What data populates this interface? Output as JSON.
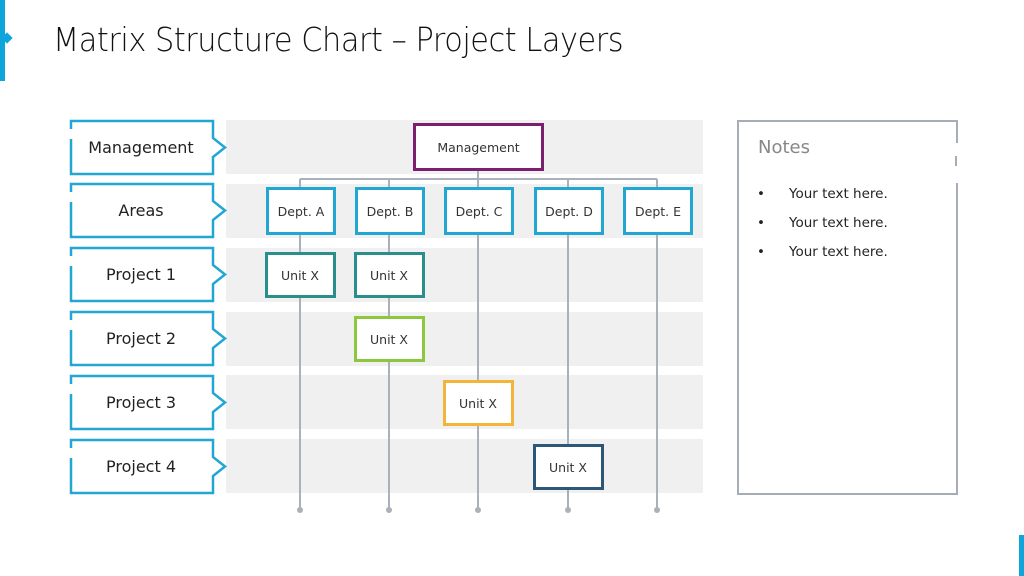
{
  "slide": {
    "title": "Matrix Structure Chart – Project Layers",
    "accent_color": "#0ea5dc"
  },
  "rows": [
    {
      "label": "Management"
    },
    {
      "label": "Areas"
    },
    {
      "label": "Project 1"
    },
    {
      "label": "Project 2"
    },
    {
      "label": "Project 3"
    },
    {
      "label": "Project 4"
    }
  ],
  "management_node": {
    "label": "Management",
    "color": "#7b1f6f"
  },
  "departments": [
    {
      "label": "Dept. A",
      "color": "#22a7d3"
    },
    {
      "label": "Dept. B",
      "color": "#22a7d3"
    },
    {
      "label": "Dept. C",
      "color": "#22a7d3"
    },
    {
      "label": "Dept. D",
      "color": "#22a7d3"
    },
    {
      "label": "Dept. E",
      "color": "#22a7d3"
    }
  ],
  "units": [
    {
      "label": "Unit X",
      "project": "Project 1",
      "department": "Dept. A",
      "color": "#2a8f8c"
    },
    {
      "label": "Unit X",
      "project": "Project 1",
      "department": "Dept. B",
      "color": "#2a8f8c"
    },
    {
      "label": "Unit X",
      "project": "Project 2",
      "department": "Dept. B",
      "color": "#8dc63f"
    },
    {
      "label": "Unit X",
      "project": "Project 3",
      "department": "Dept. C",
      "color": "#f2b53a"
    },
    {
      "label": "Unit X",
      "project": "Project 4",
      "department": "Dept. D",
      "color": "#2b5878"
    }
  ],
  "connector_color": "#a9b1bb",
  "label_border_color": "#22a7d3",
  "notes": {
    "title": "Notes",
    "bullet": "•",
    "items": [
      "Your text here.",
      "Your text here.",
      "Your text here."
    ]
  }
}
